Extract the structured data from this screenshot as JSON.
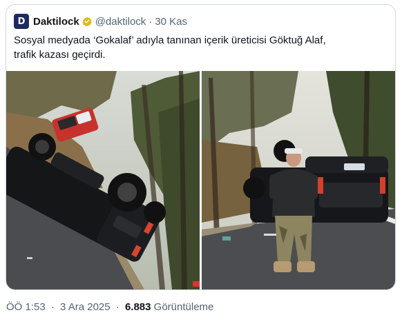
{
  "quoted_tweet": {
    "avatar_text": "D",
    "author_name": "Daktilock",
    "handle": "@daktilock",
    "separator": "·",
    "date": "30 Kas",
    "text_line1": "Sosyal medyada ‘Gokalaf’ adıyla tanınan içerik üreticisi Göktuğ Alaf,",
    "text_line2": "trafik kazası geçirdi.",
    "media": [
      {
        "alt": "overturned black pickup truck on a forest road"
      },
      {
        "alt": "man posing in front of overturned pickup truck"
      }
    ]
  },
  "footer": {
    "time": "ÖÖ 1:53",
    "separator": "·",
    "date": "3 Ara 2025",
    "views": "6.883",
    "views_label": "Görüntüleme"
  },
  "colors": {
    "text": "#0f1419",
    "secondary": "#536471",
    "border": "#cfd9de",
    "verified_gold": "#e2b719",
    "avatar_bg": "#1d2a5c"
  },
  "icons": {
    "verified": "verified-badge-icon"
  }
}
